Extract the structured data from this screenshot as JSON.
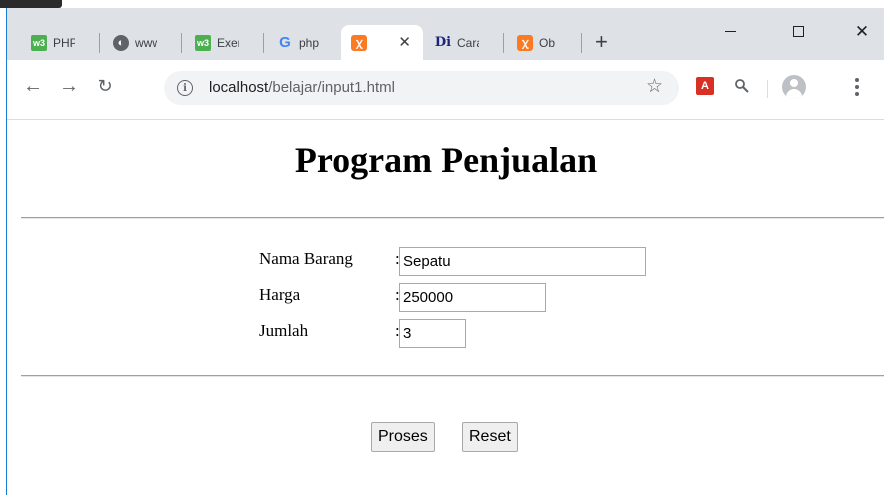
{
  "browser": {
    "tabs": [
      {
        "title": "PHP",
        "icon": "w3schools-icon",
        "active": false
      },
      {
        "title": "www",
        "icon": "globe-icon",
        "active": false
      },
      {
        "title": "Exercise",
        "icon": "w3schools-icon",
        "active": false
      },
      {
        "title": "php",
        "icon": "google-icon",
        "active": false
      },
      {
        "title": "",
        "icon": "xampp-icon",
        "active": true
      },
      {
        "title": "Cara",
        "icon": "dicoding-icon",
        "active": false
      },
      {
        "title": "Ob",
        "icon": "xampp-icon",
        "active": false
      }
    ],
    "new_tab": "+",
    "address": {
      "host": "localhost",
      "path": "/belajar/input1.html"
    }
  },
  "page": {
    "title": "Program Penjualan",
    "form": {
      "nama_barang": {
        "label": "Nama Barang",
        "colon": ":",
        "value": "Sepatu"
      },
      "harga": {
        "label": "Harga",
        "colon": ":",
        "value": "250000"
      },
      "jumlah": {
        "label": "Jumlah",
        "colon": ":",
        "value": "3"
      }
    },
    "buttons": {
      "proses": "Proses",
      "reset": "Reset"
    }
  }
}
